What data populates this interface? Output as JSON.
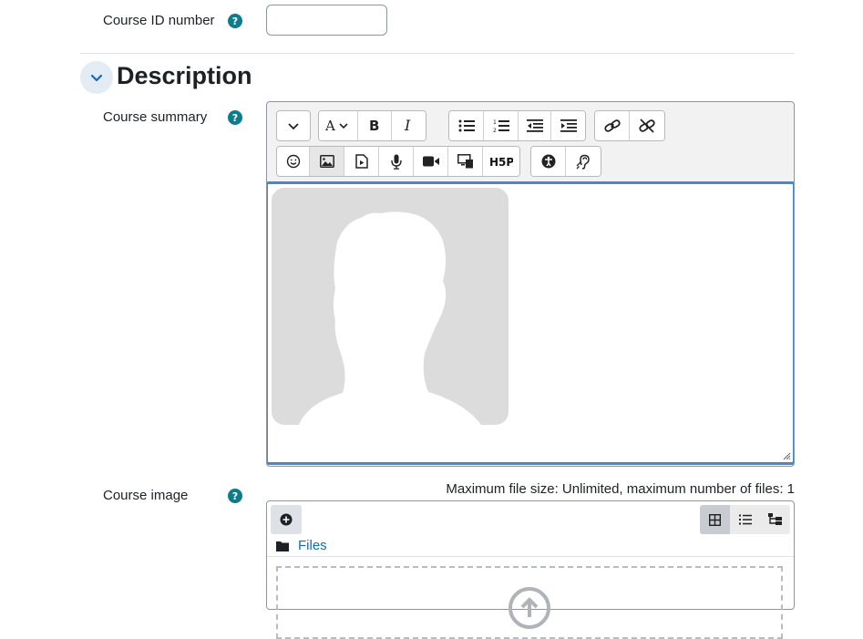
{
  "fields": {
    "course_id": {
      "label": "Course ID number",
      "value": "",
      "help": "?"
    },
    "course_summary": {
      "label": "Course summary",
      "help": "?"
    },
    "course_image": {
      "label": "Course image",
      "help": "?"
    }
  },
  "section": {
    "title": "Description"
  },
  "toolbar": {
    "row1": [
      [
        "expand-icon"
      ],
      [
        "font-icon",
        "bold-icon",
        "italic-icon"
      ],
      [
        "bullet-list-icon",
        "numbered-list-icon",
        "outdent-icon",
        "indent-icon"
      ],
      [
        "link-icon",
        "unlink-icon"
      ]
    ],
    "row2": [
      [
        "emoji-icon",
        "image-icon",
        "media-icon",
        "record-audio-icon",
        "record-video-icon",
        "manage-files-icon",
        "h5p-icon"
      ],
      [
        "accessibility-checker-icon",
        "screenreader-helper-icon"
      ]
    ],
    "h5p_text": "H5P"
  },
  "filepicker": {
    "max_size_text": "Maximum file size: Unlimited, maximum number of files: 1",
    "path_label": "Files"
  },
  "colors": {
    "accent": "#0f6cbf",
    "help": "#0f7c8c",
    "focus": "#4a86c8"
  }
}
